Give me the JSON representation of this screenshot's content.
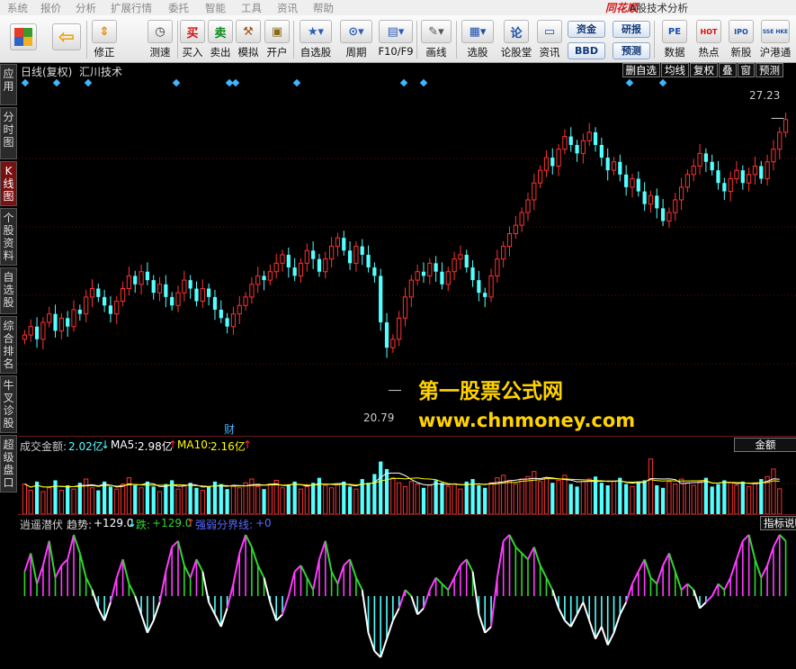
{
  "menu": [
    "系统",
    "报价",
    "分析",
    "扩展行情",
    "委托",
    "智能",
    "工具",
    "资讯",
    "帮助"
  ],
  "brand": "同花顺",
  "app_title": "- A股技术分析",
  "toolbar": {
    "buttons": [
      {
        "name": "home-button",
        "label": "",
        "icon": "grid-icon"
      },
      {
        "name": "back-button",
        "label": "",
        "icon": "arrow-left-icon"
      },
      {
        "name": "fix-button",
        "label": "修正",
        "icon": "updown-icon"
      },
      {
        "name": "speedtest-button",
        "label": "测速",
        "icon": "clock-icon"
      },
      {
        "name": "buy-button",
        "label": "买入",
        "icon": "buy-icon",
        "glyph": "买"
      },
      {
        "name": "sell-button",
        "label": "卖出",
        "icon": "sell-icon",
        "glyph": "卖"
      },
      {
        "name": "simulate-button",
        "label": "模拟",
        "icon": "hammer-icon"
      },
      {
        "name": "open-account-button",
        "label": "开户",
        "icon": "lock-icon"
      },
      {
        "name": "watchlist-button",
        "label": "自选股",
        "icon": "star-icon"
      },
      {
        "name": "period-button",
        "label": "周期",
        "icon": "period-icon"
      },
      {
        "name": "f10-button",
        "label": "F10/F9",
        "icon": "f10-icon"
      },
      {
        "name": "draw-button",
        "label": "画线",
        "icon": "pencil-icon"
      },
      {
        "name": "stock-select-button",
        "label": "选股",
        "icon": "select-icon"
      },
      {
        "name": "forum-button",
        "label": "论股堂",
        "icon": "forum-icon",
        "glyph": "论"
      },
      {
        "name": "news-button",
        "label": "资讯",
        "icon": "news-icon"
      },
      {
        "name": "data-button",
        "label": "数据",
        "icon": "pe-icon",
        "glyph": "PE"
      },
      {
        "name": "hotspot-button",
        "label": "热点",
        "icon": "hot-icon",
        "glyph": "HOT"
      },
      {
        "name": "ipo-button",
        "label": "新股",
        "icon": "ipo-icon",
        "glyph": "IPO"
      },
      {
        "name": "hk-connect-button",
        "label": "沪港通",
        "icon": "hk-icon",
        "glyph": "SSE HKE"
      }
    ],
    "pills": {
      "fund": "资金",
      "bbd": "BBD",
      "research": "研报",
      "forecast": "预测"
    }
  },
  "sidetabs": [
    "应用",
    "分时图",
    "K线图",
    "个股资料",
    "自选股",
    "综合排名",
    "牛叉诊股",
    "超级盘口"
  ],
  "active_tab": "K线图",
  "kline_panel": {
    "header": "日线(复权)",
    "indicator": "汇川技术",
    "buttons": [
      "删自选",
      "均线",
      "复权",
      "叠",
      "窗",
      "预测"
    ],
    "high_label": "27.23",
    "low_label": "20.79",
    "event_marker": "财",
    "y_range": [
      19.8,
      27.9
    ]
  },
  "volume_panel": {
    "label": "成交金额:",
    "value": "2.02亿",
    "value_arrow": "↓",
    "ma5_label": "MA5:",
    "ma5": "2.98亿",
    "ma5_arrow": "↑",
    "ma10_label": "MA10:",
    "ma10": "2.16亿",
    "ma10_arrow": "↑",
    "button": "金额"
  },
  "indicator_panel": {
    "name": "逍遥潜伏",
    "trend_label": "趋势:",
    "trend": "+129.0",
    "trend_arrow": "↓",
    "fall_label": "跌:",
    "fall": "+129.0",
    "fall_arrow": "↑",
    "boundary_label": "强弱分界线:",
    "boundary": "+0",
    "button": "指标说明"
  },
  "watermark": {
    "title": "第一股票公式网",
    "url": "www.chnmoney.com"
  },
  "colors": {
    "up": "#ff3232",
    "down": "#54ffff",
    "ma5": "#ffffff",
    "ma10": "#ffff00",
    "osc_up": "#ff3cff",
    "osc_down": "#54ffff",
    "osc_green": "#30d530"
  },
  "chart_data": {
    "type": "candlestick",
    "title": "汇川技术 日线(复权)",
    "ylim": [
      19.8,
      27.9
    ],
    "high": 27.23,
    "low": 20.79,
    "close": [
      22.1,
      22.3,
      22.0,
      22.4,
      22.6,
      22.2,
      22.5,
      22.3,
      22.7,
      22.6,
      23.0,
      23.2,
      23.0,
      22.8,
      22.6,
      22.9,
      23.2,
      23.5,
      23.3,
      23.6,
      23.4,
      23.1,
      23.3,
      23.0,
      22.8,
      23.1,
      23.4,
      23.2,
      22.9,
      23.2,
      23.0,
      22.7,
      22.5,
      22.3,
      22.6,
      22.8,
      23.0,
      23.3,
      23.5,
      23.4,
      23.6,
      23.8,
      24.0,
      23.7,
      23.5,
      23.8,
      24.1,
      23.9,
      23.6,
      23.9,
      24.2,
      24.4,
      24.1,
      23.8,
      24.2,
      24.0,
      23.7,
      23.5,
      22.4,
      21.8,
      22.0,
      22.5,
      23.0,
      23.4,
      23.6,
      23.5,
      23.8,
      23.6,
      23.3,
      23.6,
      23.9,
      24.0,
      23.7,
      23.4,
      23.1,
      23.0,
      23.5,
      23.9,
      24.2,
      24.5,
      24.7,
      25.0,
      25.3,
      25.7,
      26.0,
      26.3,
      26.1,
      26.5,
      26.8,
      26.6,
      26.4,
      26.7,
      26.9,
      26.6,
      26.3,
      26.0,
      26.2,
      25.9,
      25.6,
      25.8,
      25.5,
      25.2,
      25.4,
      25.1,
      24.8,
      25.0,
      25.3,
      25.6,
      25.9,
      26.1,
      26.4,
      26.2,
      26.0,
      25.7,
      25.5,
      25.8,
      26.0,
      25.7,
      25.9,
      26.1,
      25.8,
      26.2,
      26.5,
      26.9,
      27.2
    ],
    "volume_series": {
      "name": "成交金额",
      "values": [
        2.4,
        1.9,
        2.6,
        1.8,
        2.1,
        2.7,
        1.9,
        2.3,
        2.0,
        2.5,
        2.8,
        2.1,
        1.9,
        2.6,
        2.2,
        2.0,
        2.4,
        2.9,
        2.3,
        2.1,
        2.6,
        2.2,
        1.8,
        2.4,
        2.7,
        2.0,
        2.3,
        2.5,
        2.1,
        1.9,
        2.2,
        2.6,
        2.4,
        2.0,
        2.3,
        2.1,
        2.5,
        2.8,
        2.2,
        2.0,
        2.4,
        2.7,
        2.1,
        2.3,
        2.6,
        2.0,
        2.2,
        2.5,
        2.9,
        2.3,
        2.1,
        2.4,
        2.6,
        2.2,
        2.0,
        2.8,
        2.5,
        3.2,
        4.2,
        3.6,
        2.9,
        2.5,
        2.2,
        2.6,
        2.4,
        2.1,
        2.3,
        2.7,
        2.5,
        2.2,
        2.4,
        2.0,
        2.6,
        2.8,
        2.3,
        2.1,
        2.5,
        2.9,
        3.1,
        2.7,
        2.4,
        2.8,
        3.0,
        3.4,
        2.6,
        2.9,
        2.5,
        2.7,
        3.1,
        2.4,
        2.2,
        2.6,
        2.8,
        3.0,
        2.5,
        2.3,
        2.6,
        2.9,
        2.4,
        2.2,
        2.5,
        2.7,
        4.4,
        2.3,
        2.1,
        2.6,
        2.4,
        2.8,
        2.5,
        2.3,
        2.6,
        2.9,
        2.2,
        2.4,
        2.7,
        2.5,
        2.3,
        2.6,
        2.2,
        2.5,
        2.8,
        3.0,
        3.6,
        2.02
      ]
    },
    "oscillator_series": {
      "name": "逍遥潜伏",
      "values": [
        0.4,
        0.7,
        0.2,
        0.5,
        0.9,
        0.3,
        0.5,
        0.6,
        1.0,
        0.7,
        0.3,
        0.1,
        -0.2,
        -0.4,
        -0.1,
        0.3,
        0.6,
        0.2,
        0.0,
        -0.3,
        -0.6,
        -0.4,
        -0.1,
        0.4,
        0.8,
        0.9,
        0.5,
        0.3,
        0.6,
        0.4,
        -0.1,
        -0.3,
        -0.5,
        -0.2,
        0.2,
        0.7,
        1.0,
        0.8,
        0.5,
        0.3,
        -0.1,
        -0.4,
        -0.3,
        0.0,
        0.4,
        0.5,
        0.3,
        0.1,
        0.6,
        0.9,
        0.4,
        0.2,
        0.5,
        0.6,
        0.3,
        0.1,
        -0.6,
        -0.9,
        -1.0,
        -0.7,
        -0.4,
        -0.2,
        0.1,
        0.0,
        -0.3,
        -0.2,
        0.1,
        0.3,
        0.2,
        0.1,
        0.3,
        0.5,
        0.6,
        0.4,
        -0.3,
        -0.6,
        -0.5,
        0.3,
        0.9,
        1.0,
        0.8,
        0.7,
        0.6,
        0.8,
        0.5,
        0.3,
        0.1,
        -0.2,
        -0.4,
        -0.5,
        -0.3,
        -0.1,
        -0.4,
        -0.7,
        -0.5,
        -0.8,
        -0.6,
        -0.3,
        -0.1,
        0.2,
        0.4,
        0.6,
        0.3,
        0.2,
        0.5,
        0.7,
        0.4,
        0.1,
        0.2,
        0.1,
        -0.2,
        -0.1,
        0.0,
        0.2,
        0.1,
        0.3,
        0.6,
        0.9,
        1.0,
        0.6,
        0.3,
        0.5,
        0.8,
        1.0,
        0.9
      ]
    }
  }
}
